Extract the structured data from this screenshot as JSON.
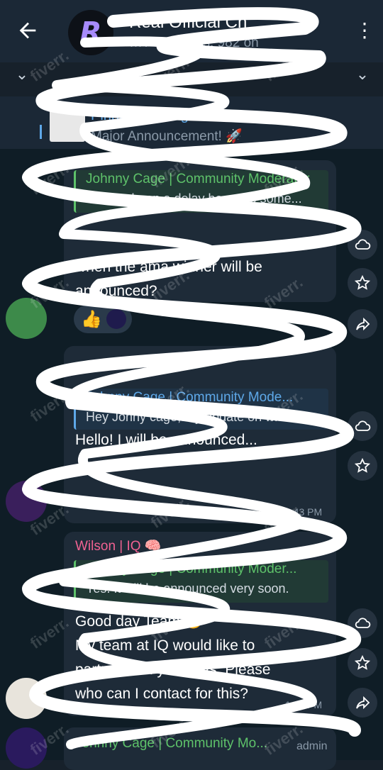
{
  "header": {
    "title": "Real Official Ch",
    "subtitle": "…? Members, 982 on",
    "back_icon": "arrow-left-icon",
    "more_icon": "more-vert-icon",
    "avatar_letter": "R"
  },
  "pinned": {
    "label": "Pinned Message",
    "text": "Major Announcement! 🚀"
  },
  "messages": [
    {
      "reply_name": "Johnny Cage | Community Moderator",
      "reply_text": "There's been a delay because some...",
      "lines": [
        "when the ama winner will be",
        "announced?"
      ],
      "reaction": "👍"
    },
    {
      "reply_name": "Johnny Cage | Community Mode...",
      "reply_text": "Hey Jonny cage,any update on wh...",
      "lines": [
        "Hello! I will be announced..."
      ],
      "time": "1:43 PM"
    },
    {
      "sender": "Wilson | IQ 🧠",
      "reply_name": "Johnny Cage | Community Moder...",
      "reply_text": "Yes. It will be announced very soon.",
      "lines": [
        "Good day Team 🙂",
        "My team at IQ would like to",
        "partner with you guys. Please",
        "who can I contact for this?"
      ],
      "time": "1:53 PM"
    },
    {
      "sender": "Johnny Cage | Community Mo...",
      "badge": "admin"
    }
  ],
  "side_buttons": [
    "cloud-icon",
    "star-icon",
    "share-icon"
  ],
  "watermark": "fiverr."
}
